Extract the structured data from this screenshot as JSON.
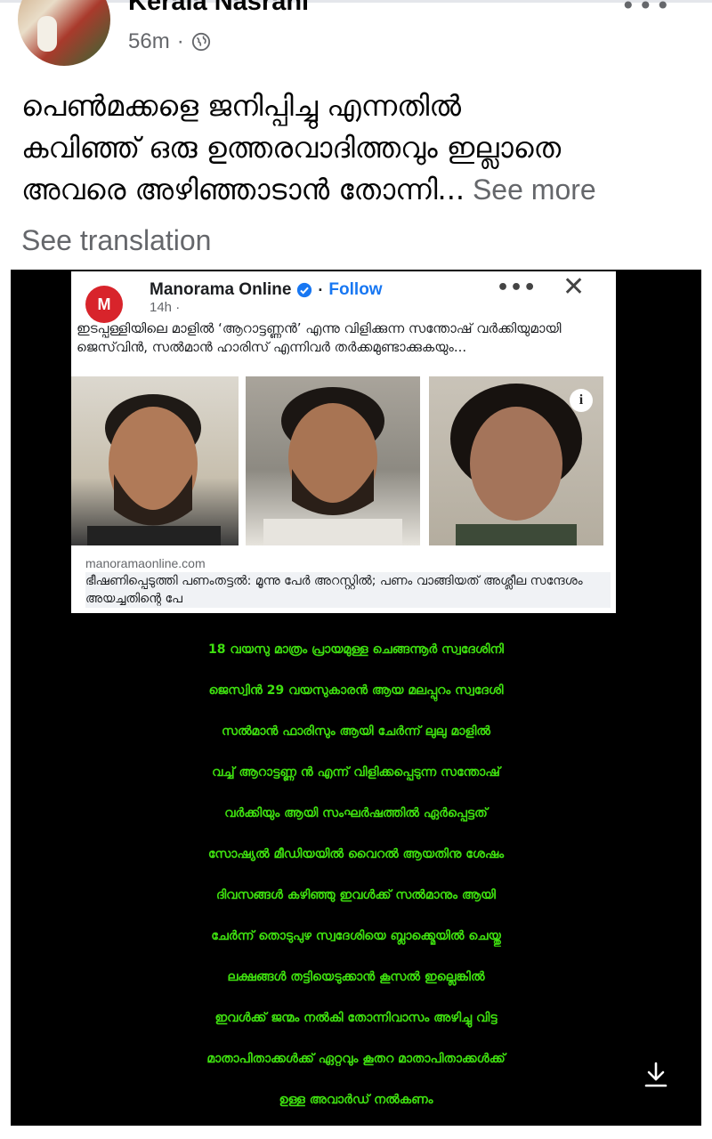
{
  "post": {
    "author": "Kerala Nasrani",
    "time": "56m",
    "meta_separator": "·",
    "text_lines": [
      "പെൺമക്കളെ ജനിപ്പിച്ചു  എന്നതിൽ",
      "കവിഞ്ഞ് ഒരു ഉത്തരവാദിത്തവും ഇല്ലാതെ",
      "അവരെ അഴിഞ്ഞാടാൻ തോന്നി..."
    ],
    "see_more": " See more",
    "see_translation": "See translation"
  },
  "embedded_card": {
    "logo_text": "M",
    "page_name": "Manorama Online",
    "dot": "·",
    "follow": "Follow",
    "time": "14h ·",
    "more": "•••",
    "close": "✕",
    "caption": "ഇടപ്പള്ളിയിലെ മാളിൽ ‘ആറാട്ടണ്ണൻ’ എന്നു വിളിക്കുന്ന സന്തോഷ് വർക്കിയുമായി ജെസ്‌വിൻ, സൽമാൻ ഹാരിസ് എന്നിവർ തർക്കമുണ്ടാക്കുകയും...",
    "info": "i",
    "domain": "manoramaonline.com",
    "headline": "ഭീഷണിപ്പെടുത്തി പണംതട്ടൽ: മൂന്നു പേർ അറസ്റ്റിൽ; പണം വാങ്ങിയത് അശ്ലീല സന്ദേശം അയച്ചതിന്റെ പേ"
  },
  "image_text": {
    "lines": [
      "18 വയസു മാത്രം പ്രായമുള്ള ചെങ്ങന്നൂർ സ്വദേശിനി",
      "ജെസ്വിൻ  29 വയസുകാരൻ ആയ മലപ്പുറം സ്വദേശി",
      "സൽമാൻ  ഫാരിസും ആയി ചേർന്ന് ലുലു മാളിൽ",
      "വച്ച് ആറാട്ടണ്ണ ൻ  എന്ന് വിളിക്കപ്പെടുന്ന സന്തോഷ്",
      "വർക്കിയും ആയി സംഘർഷത്തിൽ ഏർപ്പെട്ടത്",
      "സോഷ്യൽ മീഡിയയിൽ വൈറൽ ആയതിനു ശേഷം",
      "ദിവസങ്ങൾ കഴിഞ്ഞു  ഇവൾക്ക്  സൽമാനും ആയി",
      "ചേർന്ന് തൊടുപുഴ സ്വദേശിയെ ബ്ലാക്ക്മെയിൽ ചെയ്തു",
      "ലക്ഷങ്ങൾ തട്ടിയെടുക്കാൻ കൂസൽ ഇല്ലെങ്കിൽ",
      "ഇവൾക്ക് ജന്മം നൽകി തോന്നിവാസം അഴിച്ചു വിട്ട",
      "മാതാപിതാക്കൾക്ക് ഏറ്റവും കൂതറ മാതാപിതാക്കൾക്ക്",
      "ഉള്ള അവാർഡ് നൽകണം"
    ]
  },
  "colors": {
    "green_text": "#3ee00f",
    "link_blue": "#1877f2",
    "secondary_gray": "#65676b",
    "logo_red": "#d8242b"
  },
  "icons": [
    "globe-icon",
    "verified-icon",
    "info-icon",
    "download-icon"
  ]
}
